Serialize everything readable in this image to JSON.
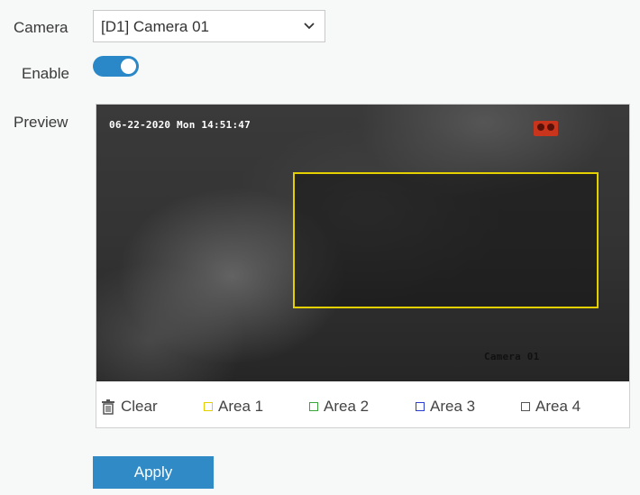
{
  "camera": {
    "label": "Camera",
    "selected": "[D1] Camera 01"
  },
  "enable": {
    "label": "Enable",
    "on": true
  },
  "preview": {
    "label": "Preview",
    "osd_time": "06-22-2020 Mon 14:51:47",
    "osd_name": "Camera 01"
  },
  "toolbar": {
    "clear": "Clear",
    "areas": [
      {
        "label": "Area 1",
        "color": "#e4d000"
      },
      {
        "label": "Area 2",
        "color": "#3aa53a"
      },
      {
        "label": "Area 3",
        "color": "#2a3fd0"
      },
      {
        "label": "Area 4",
        "color": "#555555"
      }
    ]
  },
  "apply": "Apply",
  "colors": {
    "accent": "#2f8ac6",
    "area_outline": "#e4d000"
  }
}
